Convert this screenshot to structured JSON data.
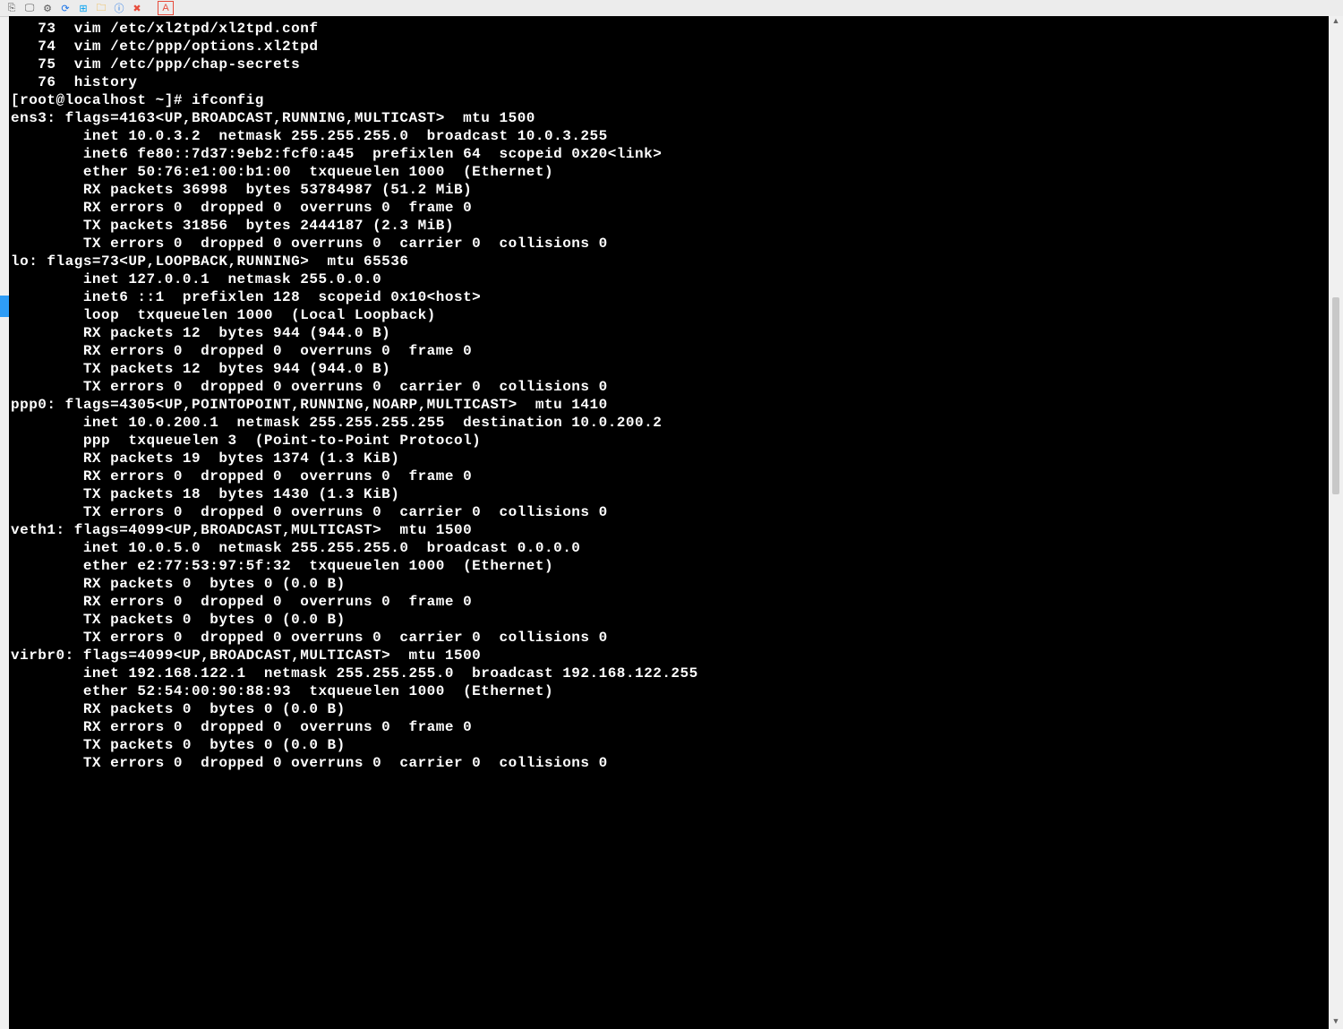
{
  "toolbar_icons": [
    "link-icon",
    "monitor-icon",
    "gear-icon",
    "refresh-icon",
    "windows-icon",
    "folder-icon",
    "info-icon",
    "close-icon",
    "pdf-icon"
  ],
  "terminal_lines": [
    "   73  vim /etc/xl2tpd/xl2tpd.conf",
    "   74  vim /etc/ppp/options.xl2tpd",
    "   75  vim /etc/ppp/chap-secrets",
    "   76  history",
    "[root@localhost ~]# ifconfig",
    "ens3: flags=4163<UP,BROADCAST,RUNNING,MULTICAST>  mtu 1500",
    "        inet 10.0.3.2  netmask 255.255.255.0  broadcast 10.0.3.255",
    "        inet6 fe80::7d37:9eb2:fcf0:a45  prefixlen 64  scopeid 0x20<link>",
    "        ether 50:76:e1:00:b1:00  txqueuelen 1000  (Ethernet)",
    "        RX packets 36998  bytes 53784987 (51.2 MiB)",
    "        RX errors 0  dropped 0  overruns 0  frame 0",
    "        TX packets 31856  bytes 2444187 (2.3 MiB)",
    "        TX errors 0  dropped 0 overruns 0  carrier 0  collisions 0",
    "",
    "lo: flags=73<UP,LOOPBACK,RUNNING>  mtu 65536",
    "        inet 127.0.0.1  netmask 255.0.0.0",
    "        inet6 ::1  prefixlen 128  scopeid 0x10<host>",
    "        loop  txqueuelen 1000  (Local Loopback)",
    "        RX packets 12  bytes 944 (944.0 B)",
    "        RX errors 0  dropped 0  overruns 0  frame 0",
    "        TX packets 12  bytes 944 (944.0 B)",
    "        TX errors 0  dropped 0 overruns 0  carrier 0  collisions 0",
    "",
    "ppp0: flags=4305<UP,POINTOPOINT,RUNNING,NOARP,MULTICAST>  mtu 1410",
    "        inet 10.0.200.1  netmask 255.255.255.255  destination 10.0.200.2",
    "        ppp  txqueuelen 3  (Point-to-Point Protocol)",
    "        RX packets 19  bytes 1374 (1.3 KiB)",
    "        RX errors 0  dropped 0  overruns 0  frame 0",
    "        TX packets 18  bytes 1430 (1.3 KiB)",
    "        TX errors 0  dropped 0 overruns 0  carrier 0  collisions 0",
    "",
    "veth1: flags=4099<UP,BROADCAST,MULTICAST>  mtu 1500",
    "        inet 10.0.5.0  netmask 255.255.255.0  broadcast 0.0.0.0",
    "        ether e2:77:53:97:5f:32  txqueuelen 1000  (Ethernet)",
    "        RX packets 0  bytes 0 (0.0 B)",
    "        RX errors 0  dropped 0  overruns 0  frame 0",
    "        TX packets 0  bytes 0 (0.0 B)",
    "        TX errors 0  dropped 0 overruns 0  carrier 0  collisions 0",
    "",
    "virbr0: flags=4099<UP,BROADCAST,MULTICAST>  mtu 1500",
    "        inet 192.168.122.1  netmask 255.255.255.0  broadcast 192.168.122.255",
    "        ether 52:54:00:90:88:93  txqueuelen 1000  (Ethernet)",
    "        RX packets 0  bytes 0 (0.0 B)",
    "        RX errors 0  dropped 0  overruns 0  frame 0",
    "        TX packets 0  bytes 0 (0.0 B)",
    "        TX errors 0  dropped 0 overruns 0  carrier 0  collisions 0",
    ""
  ]
}
